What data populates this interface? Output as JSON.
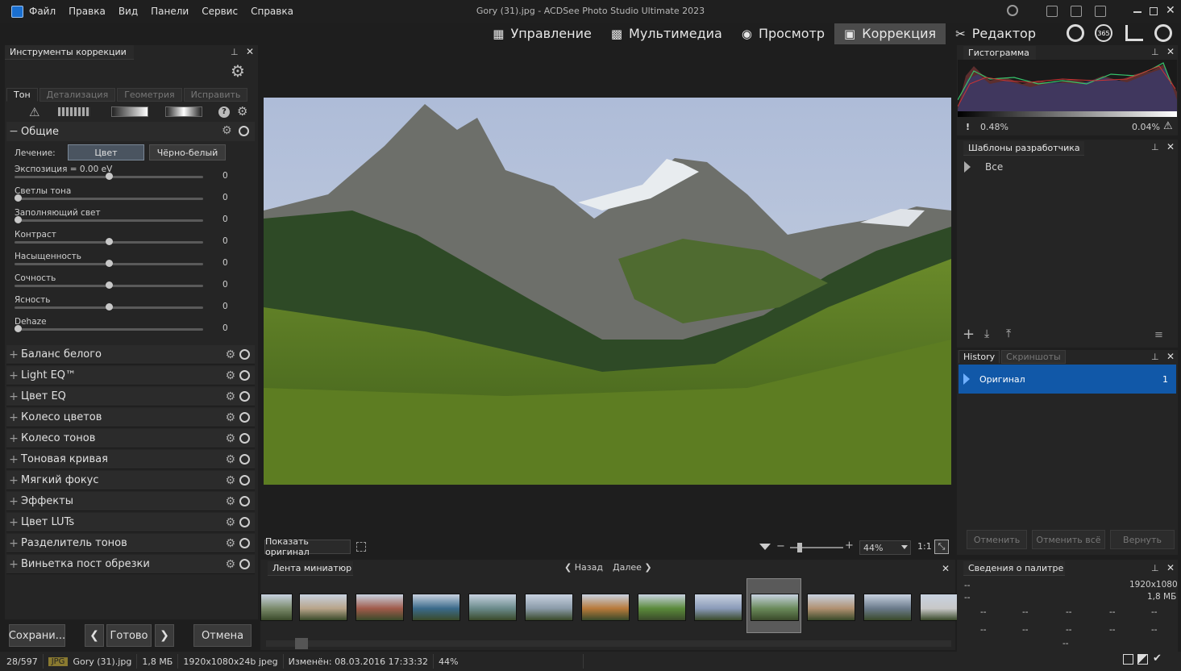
{
  "app": {
    "title": "Gory (31).jpg - ACDSee Photo Studio Ultimate 2023"
  },
  "menu": [
    "Файл",
    "Правка",
    "Вид",
    "Панели",
    "Сервис",
    "Справка"
  ],
  "modes": [
    {
      "label": "Управление",
      "icon": "grid-icon"
    },
    {
      "label": "Мультимедиа",
      "icon": "media-icon"
    },
    {
      "label": "Просмотр",
      "icon": "eye-icon"
    },
    {
      "label": "Коррекция",
      "icon": "develop-icon",
      "active": true
    },
    {
      "label": "Редактор",
      "icon": "edit-icon"
    }
  ],
  "left": {
    "title": "Инструменты коррекции",
    "tabs": [
      "Тон",
      "Детализация",
      "Геометрия",
      "Исправить"
    ],
    "general": {
      "title": "Общие",
      "treatment_label": "Лечение:",
      "color_btn": "Цвет",
      "bw_btn": "Чёрно-белый"
    },
    "sliders": [
      {
        "label": "Экспозиция = 0.00 eV",
        "value": "0",
        "pos": 0.5
      },
      {
        "label": "Светлы тона",
        "value": "0",
        "pos": 0
      },
      {
        "label": "Заполняющий свет",
        "value": "0",
        "pos": 0
      },
      {
        "label": "Контраст",
        "value": "0",
        "pos": 0.5
      },
      {
        "label": "Насыщенность",
        "value": "0",
        "pos": 0.5
      },
      {
        "label": "Сочность",
        "value": "0",
        "pos": 0.5
      },
      {
        "label": "Ясность",
        "value": "0",
        "pos": 0.5
      },
      {
        "label": "Dehaze",
        "value": "0",
        "pos": 0
      }
    ],
    "sections": [
      "Баланс белого",
      "Light EQ™",
      "Цвет EQ",
      "Колесо цветов",
      "Колесо тонов",
      "Тоновая кривая",
      "Мягкий фокус",
      "Эффекты",
      "Цвет LUTs",
      "Разделитель тонов",
      "Виньетка пост обрезки"
    ],
    "save": "Сохрани...",
    "done": "Готово",
    "cancel": "Отмена"
  },
  "viewer": {
    "show_original": "Показать оригинал",
    "zoom": "44%",
    "ratio": "1:1"
  },
  "filmstrip": {
    "title": "Лента миниатюр",
    "back": "Назад",
    "next": "Далее"
  },
  "histogram": {
    "title": "Гистограмма",
    "left": "0.48%",
    "right": "0.04%"
  },
  "presets": {
    "title": "Шаблоны разработчика",
    "item": "Все"
  },
  "history": {
    "tabs": [
      "History",
      "Скриншоты"
    ],
    "item": "Оригинал",
    "count": "1",
    "undo": "Отменить",
    "undo_all": "Отменить всё",
    "redo": "Вернуть"
  },
  "palette": {
    "title": "Сведения о палитре",
    "res": "1920x1080",
    "size": "1,8 МБ",
    "dash": "--"
  },
  "status": {
    "index": "28/597",
    "type": "JPG",
    "file": "Gory (31).jpg",
    "size": "1,8 МБ",
    "dims": "1920x1080x24b jpeg",
    "modified": "Изменён: 08.03.2016 17:33:32",
    "zoom": "44%"
  }
}
